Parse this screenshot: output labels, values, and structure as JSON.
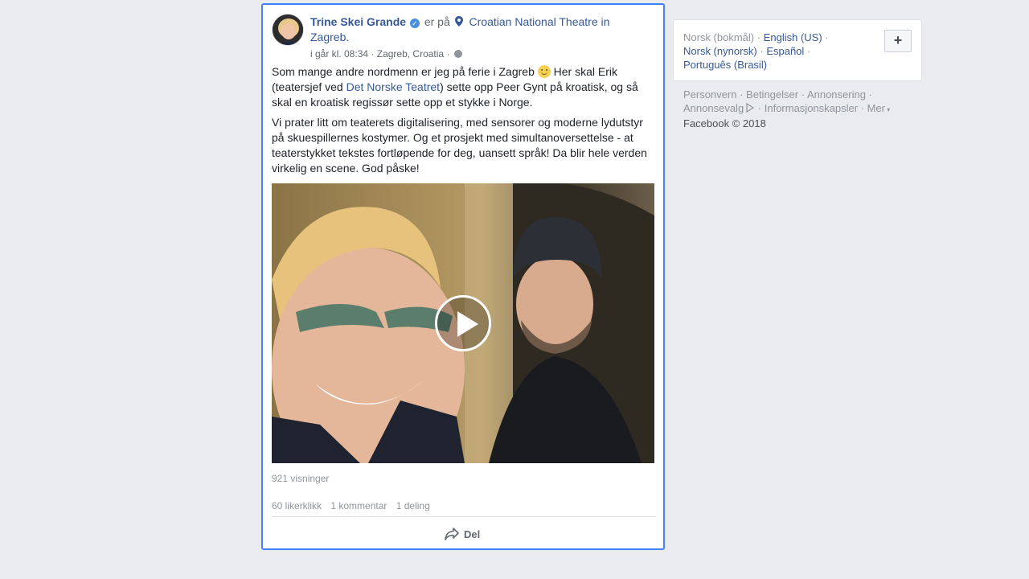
{
  "post": {
    "author": "Trine Skei Grande",
    "is_at": "er på",
    "place": "Croatian National Theatre in Zagreb.",
    "time": "i går kl. 08:34",
    "location": "Zagreb, Croatia",
    "meta_sep": "·",
    "paragraph1_a": "Som mange andre nordmenn er jeg på ferie i Zagreb",
    "paragraph1_b": " Her skal Erik (teatersjef ved ",
    "paragraph1_link": "Det Norske Teatret",
    "paragraph1_c": ") sette opp Peer Gynt på kroatisk, og så skal en kroatisk regissør sette opp et stykke i Norge.",
    "paragraph2": "Vi prater litt om teaterets digitalisering, med sensorer og moderne lydutstyr på skuespillernes kostymer. Og et prosjekt med simultanoversettelse - at teaterstykket tekstes fortløpende for deg, uansett språk! Da blir hele verden virkelig en scene. God påske!",
    "views": "921 visninger",
    "likes": "60 likerklikk",
    "comments": "1 kommentar",
    "shares": "1 deling",
    "share_label": "Del"
  },
  "languages": {
    "items": [
      "Norsk (bokmål)",
      "English (US)",
      "Norsk (nynorsk)",
      "Español",
      "Português (Brasil)"
    ],
    "add_label": "+"
  },
  "footer": {
    "links": [
      "Personvern",
      "Betingelser",
      "Annonsering",
      "Annonsevalg",
      "Informasjonskapsler",
      "Mer"
    ],
    "copyright": "Facebook © 2018"
  }
}
